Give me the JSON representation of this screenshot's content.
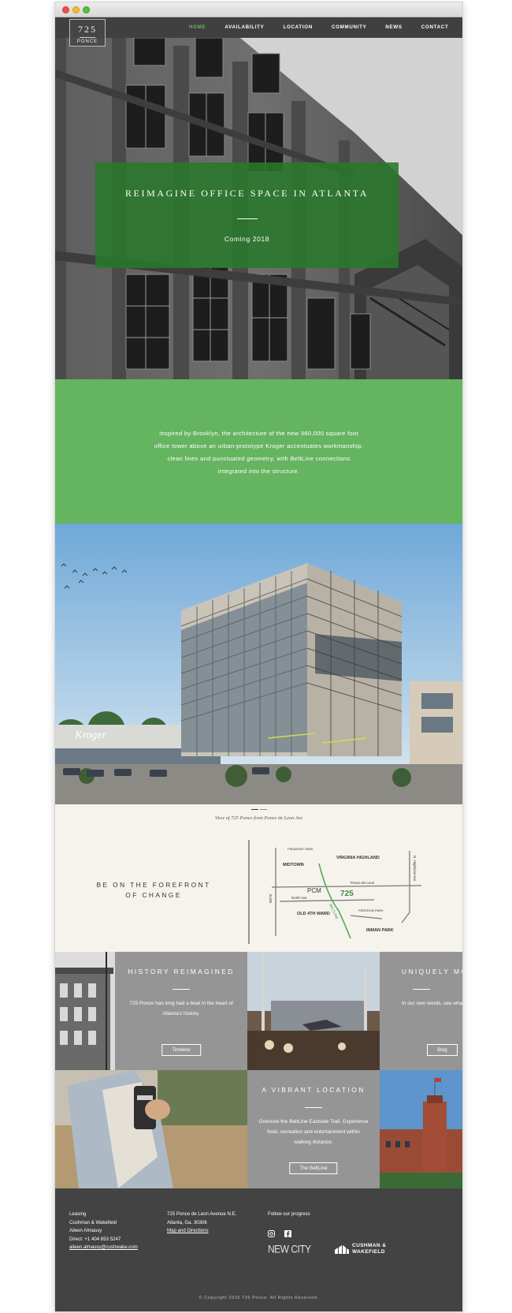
{
  "brand": {
    "number": "725",
    "name": "PONCE"
  },
  "nav": {
    "items": [
      "HOME",
      "AVAILABILITY",
      "LOCATION",
      "COMMUNITY",
      "NEWS",
      "CONTACT"
    ],
    "active": "HOME",
    "accent_color": "#69b55d"
  },
  "hero": {
    "title": "REIMAGINE OFFICE SPACE IN ATLANTA",
    "subtitle": "Coming 2018",
    "box_color": "#2a782c"
  },
  "intro": {
    "text": "Inspired by Brooklyn, the architecture of the new 360,000 square foot office tower above an urban-prototype Kroger accentuates workmanship, clean lines and punctuated geometry, with BeltLine connections integrated into the structure.",
    "background": "#65b460"
  },
  "rendering": {
    "sign": "Kroger",
    "caption": "View of 725 Ponce from Ponce de Leon Ave"
  },
  "forefront": {
    "title": "BE ON THE FOREFRONT OF CHANGE",
    "map": {
      "labels": {
        "piedmont_park": "PIEDMONT PARK",
        "midtown": "MIDTOWN",
        "virginia_highland": "VIRGINIA HIGHLAND",
        "highland_ave": "N. Highland Ave",
        "ponce": "Ponce de Leon",
        "pcm": "PCM",
        "address": "725",
        "north_ave": "North Ave",
        "interstate": "85/75",
        "beltline": "BELTLINE",
        "old_fourth_ward": "OLD 4TH WARD",
        "freedom_park": "FREEDOM PARK",
        "inman_park": "INMAN PARK"
      }
    }
  },
  "tiles": {
    "history": {
      "title": "HISTORY REIMAGINED",
      "text": "725 Ponce has long had a beat in the heart of Atlanta's history.",
      "button": "Timeline"
    },
    "unique": {
      "title": "UNIQUELY MO",
      "text": "In our own words, see wha",
      "button": "Blog"
    },
    "vibrant": {
      "title": "A VIBRANT LOCATION",
      "text": "Overlook the BeltLine Eastside Trail. Experience food, recreation and entertainment within walking distance.",
      "button": "The BeltLine"
    }
  },
  "footer": {
    "leasing": {
      "heading": "Leasing",
      "company": "Cushman & Wakefield",
      "contact": "Aileen Almassy",
      "phone": "Direct: +1 404 853 5247",
      "email": "aileen.almassy@cushwake.com"
    },
    "address": {
      "line1": "725 Ponce de Leon Avenue N.E.",
      "line2": "Atlanta, Ga. 30306",
      "link": "Map and Directions"
    },
    "follow": {
      "heading": "Follow our progress",
      "icons": [
        "instagram-icon",
        "facebook-icon"
      ]
    },
    "logos": {
      "new_city": "NEW CITY",
      "cw_line1": "CUSHMAN &",
      "cw_line2": "WAKEFIELD"
    },
    "copyright": "© Copyright 2016 725 Ponce. All Rights Reserved."
  }
}
